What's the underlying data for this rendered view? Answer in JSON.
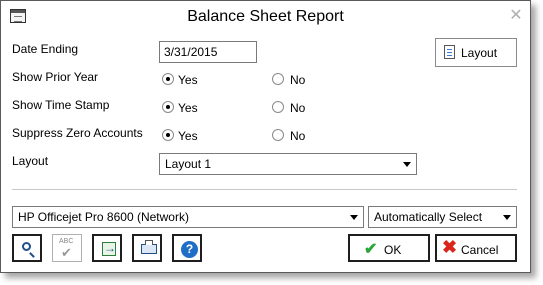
{
  "window": {
    "title": "Balance Sheet Report"
  },
  "fields": {
    "date_ending": {
      "label": "Date Ending",
      "value": "3/31/2015"
    },
    "show_prior_year": {
      "label": "Show Prior Year",
      "yes": "Yes",
      "no": "No",
      "selected": "Yes"
    },
    "show_time_stamp": {
      "label": "Show Time Stamp",
      "yes": "Yes",
      "no": "No",
      "selected": "Yes"
    },
    "suppress_zero_accounts": {
      "label": "Suppress Zero Accounts",
      "yes": "Yes",
      "no": "No",
      "selected": "Yes"
    },
    "layout": {
      "label": "Layout",
      "value": "Layout 1"
    }
  },
  "layout_button": {
    "label": "Layout"
  },
  "printer": {
    "value": "HP Officejet Pro 8600 (Network)"
  },
  "paper_source": {
    "value": "Automatically Select"
  },
  "toolbar": [
    {
      "icon": "search-icon"
    },
    {
      "icon": "spellcheck-icon",
      "text": "ABC"
    },
    {
      "icon": "export-icon"
    },
    {
      "icon": "printer-setup-icon"
    },
    {
      "icon": "help-icon",
      "text": "?"
    }
  ],
  "buttons": {
    "ok": "OK",
    "cancel": "Cancel"
  },
  "colors": {
    "ok_check": "#2aa63a",
    "cancel_x": "#d9251c",
    "help": "#1f6fc7"
  }
}
